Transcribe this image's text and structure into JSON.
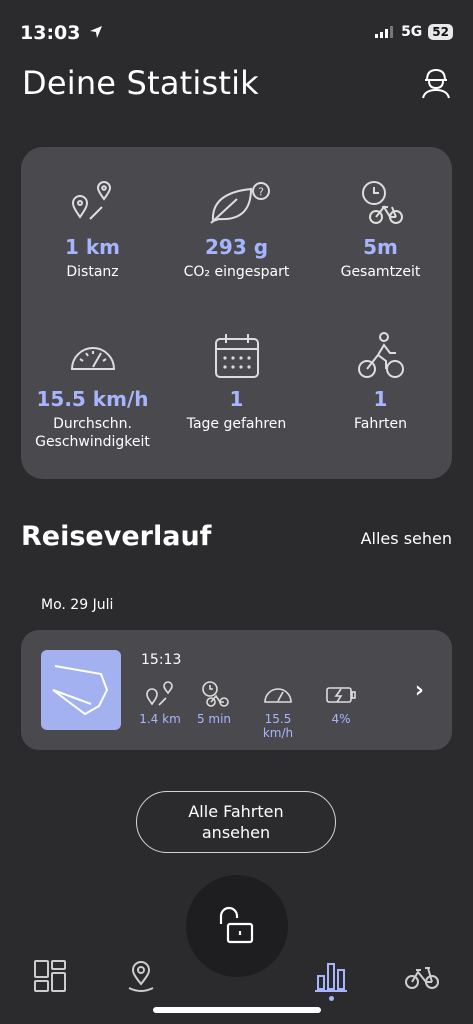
{
  "status_bar": {
    "time": "13:03",
    "network": "5G",
    "battery": "52"
  },
  "page": {
    "title": "Deine Statistik"
  },
  "stats": [
    {
      "icon": "route-pins-icon",
      "value": "1 km",
      "label": "Distanz"
    },
    {
      "icon": "leaf-icon",
      "value": "293 g",
      "label": "CO₂ eingespart"
    },
    {
      "icon": "clock-bike-icon",
      "value": "5m",
      "label": "Gesamtzeit"
    },
    {
      "icon": "speedometer-icon",
      "value": "15.5 km/h",
      "label": "Durchschn. Geschwindigkeit"
    },
    {
      "icon": "calendar-icon",
      "value": "1",
      "label": "Tage gefahren"
    },
    {
      "icon": "cyclist-icon",
      "value": "1",
      "label": "Fahrten"
    }
  ],
  "history": {
    "title": "Reiseverlauf",
    "see_all": "Alles sehen",
    "date": "Mo. 29 Juli",
    "trip": {
      "time": "15:13",
      "distance": "1.4 km",
      "duration": "5 min",
      "speed": "15.5 km/h",
      "battery": "4%"
    }
  },
  "all_trips_button": "Alle Fahrten ansehen",
  "colors": {
    "accent": "#a7b5ff",
    "card": "#4a4a4e",
    "background": "#2b2b2d"
  }
}
